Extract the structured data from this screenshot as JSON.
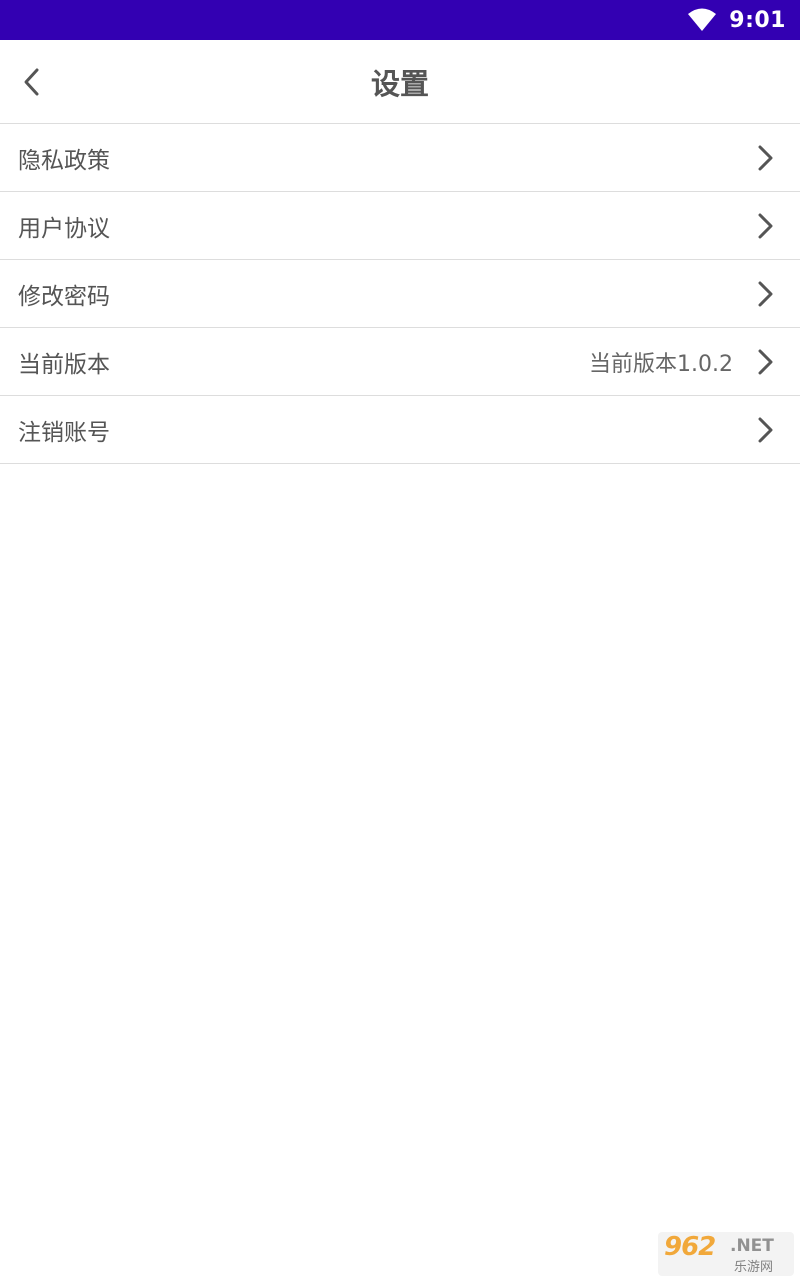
{
  "status_bar": {
    "time": "9:01",
    "wifi_icon": "wifi-icon",
    "background_color": "#3300B2"
  },
  "header": {
    "title": "设置",
    "back_icon": "chevron-left-icon"
  },
  "settings": {
    "items": [
      {
        "label": "隐私政策",
        "value": ""
      },
      {
        "label": "用户协议",
        "value": ""
      },
      {
        "label": "修改密码",
        "value": ""
      },
      {
        "label": "当前版本",
        "value": "当前版本1.0.2"
      },
      {
        "label": "注销账号",
        "value": ""
      }
    ],
    "item_icon": "chevron-right-icon"
  },
  "watermark": {
    "main": "962",
    "net": ".NET",
    "sub": "乐游网"
  }
}
